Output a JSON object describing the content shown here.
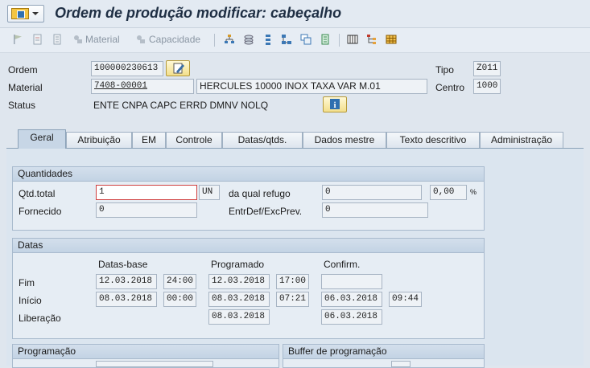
{
  "title": "Ordem de produção modificar: cabeçalho",
  "toolbar": {
    "material_label": "Material",
    "capacidade_label": "Capacidade"
  },
  "header": {
    "ordem_label": "Ordem",
    "ordem_value": "100000230613",
    "material_label": "Material",
    "material_value": "7408-00001",
    "material_desc": "HERCULES 10000 INOX TAXA VAR M.01",
    "status_label": "Status",
    "status_value": "ENTE CNPA CAPC ERRD DMNV NOLQ",
    "tipo_label": "Tipo",
    "tipo_value": "Z011",
    "centro_label": "Centro",
    "centro_value": "1000"
  },
  "tabs": [
    "Geral",
    "Atribuição",
    "EM",
    "Controle",
    "Datas/qtds.",
    "Dados mestre",
    "Texto descritivo",
    "Administração"
  ],
  "quantidades": {
    "title": "Quantidades",
    "qtd_total_label": "Qtd.total",
    "qtd_total_value": "1",
    "unit": "UN",
    "refugo_label": "da qual refugo",
    "refugo_value": "0",
    "refugo_pct": "0,00",
    "pct_sign": "%",
    "fornecido_label": "Fornecido",
    "fornecido_value": "0",
    "entrdef_label": "EntrDef/ExcPrev.",
    "entrdef_value": "0"
  },
  "datas": {
    "title": "Datas",
    "col_base": "Datas-base",
    "col_prog": "Programado",
    "col_confirm": "Confirm.",
    "fim_label": "Fim",
    "fim_base_date": "12.03.2018",
    "fim_base_time": "24:00",
    "fim_prog_date": "12.03.2018",
    "fim_prog_time": "17:00",
    "inicio_label": "Início",
    "inicio_base_date": "08.03.2018",
    "inicio_base_time": "00:00",
    "inicio_prog_date": "08.03.2018",
    "inicio_prog_time": "07:21",
    "inicio_conf_date": "06.03.2018",
    "inicio_conf_time": "09:44",
    "liberacao_label": "Liberação",
    "liberacao_prog_date": "08.03.2018",
    "liberacao_conf_date": "06.03.2018"
  },
  "programacao_title": "Programação",
  "buffer_title": "Buffer de programação"
}
